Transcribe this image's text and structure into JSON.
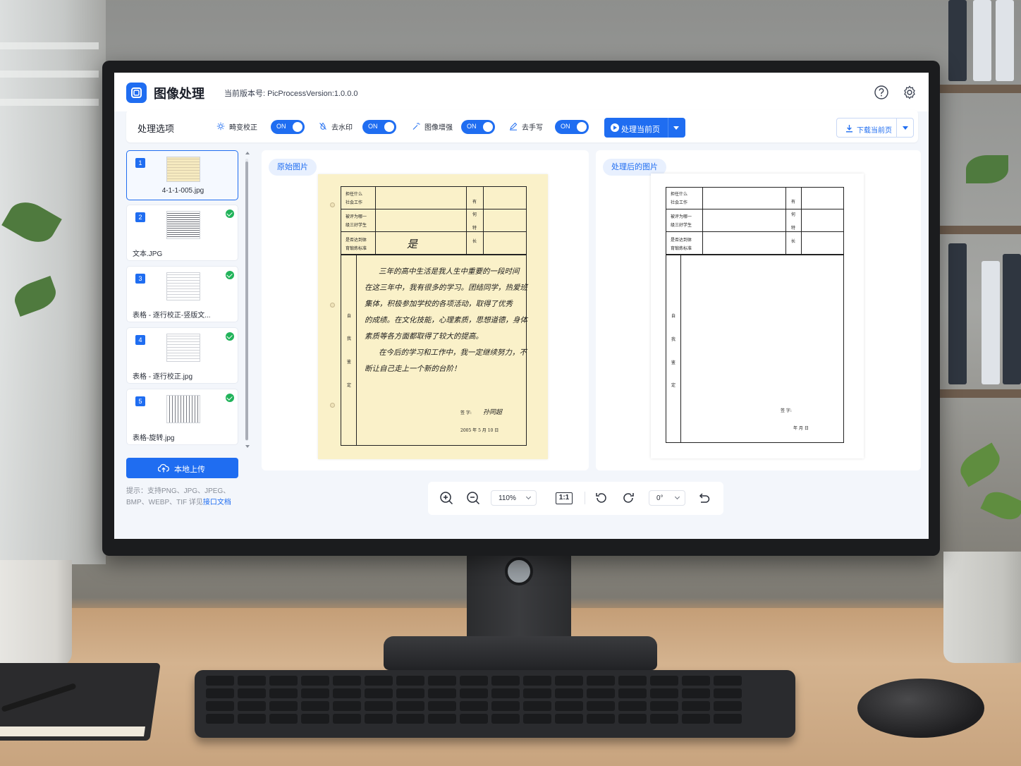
{
  "app": {
    "title": "图像处理",
    "version": "当前版本号: PicProcessVersion:1.0.0.0"
  },
  "toolbar": {
    "title": "处理选项",
    "options": [
      {
        "label": "畸变校正",
        "toggle": "ON",
        "icon": "sun-icon"
      },
      {
        "label": "去水印",
        "toggle": "ON",
        "icon": "watermark-off-icon"
      },
      {
        "label": "图像增强",
        "toggle": "ON",
        "icon": "magic-wand-icon"
      },
      {
        "label": "去手写",
        "toggle": "ON",
        "icon": "eraser-pen-icon"
      }
    ],
    "process_button": "处理当前页",
    "download_button": "下载当前页"
  },
  "sidebar": {
    "items": [
      {
        "num": "1",
        "name": "4-1-1-005.jpg",
        "done": false,
        "active": true
      },
      {
        "num": "2",
        "name": "文本.JPG",
        "done": true,
        "active": false
      },
      {
        "num": "3",
        "name": "表格 - 逐行校正-竖版文...",
        "done": true,
        "active": false
      },
      {
        "num": "4",
        "name": "表格 - 逐行校正.jpg",
        "done": true,
        "active": false
      },
      {
        "num": "5",
        "name": "表格-旋转.jpg",
        "done": true,
        "active": false
      }
    ],
    "upload_button": "本地上传",
    "hint_text": "提示：支持PNG、JPG、JPEG、BMP、WEBP、TIF 详见",
    "hint_link": "接口文档"
  },
  "panels": {
    "original_label": "原始图片",
    "processed_label": "处理后的图片"
  },
  "document": {
    "row1": [
      "担任什么",
      "社会工作"
    ],
    "row2": [
      "被评为哪一",
      "级三好学生"
    ],
    "row3": [
      "是否达到体",
      "育锻炼标准"
    ],
    "side_label": [
      "有",
      "何",
      "特",
      "长"
    ],
    "self_label": [
      "自",
      "我",
      "鉴",
      "定"
    ],
    "answer": "是",
    "handwriting": [
      "三年的高中生活是我人生中重要的一段时间",
      "在这三年中，我有很多的学习。团结同学，热爱班",
      "集体，积极参加学校的各项活动，取得了优秀",
      "的成绩。在文化技能，心理素质，思想道德，身体",
      "素质等各方面都取得了较大的提高。",
      "在今后的学习和工作中，我一定继续努力，不",
      "断让自己走上一个新的台阶！"
    ],
    "sign_label": "签  字:",
    "signature": "孙同超",
    "date_text": "2005 年   5   月   10   日",
    "date_blank": "年        月        日"
  },
  "controls": {
    "zoom": "110%",
    "one_to_one": "1:1",
    "angle": "0°"
  },
  "colors": {
    "accent": "#1f6df1",
    "success": "#21b35a",
    "paper_original": "#faf1c9"
  }
}
